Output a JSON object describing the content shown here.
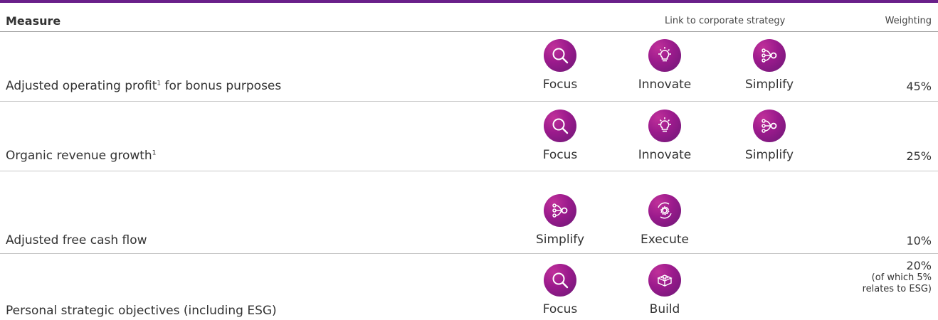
{
  "header": {
    "measure": "Measure",
    "link": "Link to corporate strategy",
    "weighting": "Weighting"
  },
  "strategy_icons": {
    "Focus": "search-icon",
    "Innovate": "lightbulb-icon",
    "Simplify": "merge-arrows-icon",
    "Execute": "gear-cycle-icon",
    "Build": "building-block-icon"
  },
  "colors": {
    "accent": "#6a1f8a",
    "icon_gradient_start": "#c0309a",
    "icon_gradient_end": "#6c1876"
  },
  "rows": [
    {
      "measure": "Adjusted operating profit",
      "sup": "1",
      "measure_suffix": " for bonus purposes",
      "links": [
        "Focus",
        "Innovate",
        "Simplify"
      ],
      "weight": "45%",
      "weight_note_1": "",
      "weight_note_2": ""
    },
    {
      "measure": "Organic revenue growth",
      "sup": "1",
      "measure_suffix": "",
      "links": [
        "Focus",
        "Innovate",
        "Simplify"
      ],
      "weight": "25%",
      "weight_note_1": "",
      "weight_note_2": ""
    },
    {
      "measure": "Adjusted free cash flow",
      "sup": "",
      "measure_suffix": "",
      "links": [
        "Simplify",
        "Execute"
      ],
      "weight": "10%",
      "weight_note_1": "",
      "weight_note_2": ""
    },
    {
      "measure": "Personal strategic objectives (including ESG)",
      "sup": "",
      "measure_suffix": "",
      "links": [
        "Focus",
        "Build"
      ],
      "weight": "20%",
      "weight_note_1": "(of which 5%",
      "weight_note_2": "relates to ESG)"
    }
  ]
}
